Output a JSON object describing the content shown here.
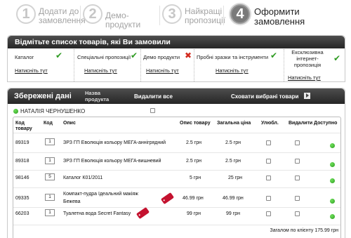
{
  "steps": [
    {
      "num": "1",
      "line1": "Додати до",
      "line2": "замовлення"
    },
    {
      "num": "2",
      "line1": "Демо-продукти",
      "line2": ""
    },
    {
      "num": "3",
      "line1": "Найкращі",
      "line2": "пропозиції"
    },
    {
      "num": "4",
      "line1": "Оформити",
      "line2": "замовлення"
    }
  ],
  "checklist": {
    "title": "Відмітьте список товарів, які Ви замовили",
    "items": [
      {
        "label": "Каталог",
        "status": "done",
        "link": "Натисніть тут"
      },
      {
        "label": "Спеціальні пропозиції",
        "status": "done",
        "link": "Натисніть тут"
      },
      {
        "label": "Демо продукти",
        "status": "missing",
        "link": "Натисніть тут"
      },
      {
        "label": "Пробні зразки та інструменти",
        "status": "done",
        "link": "Натисніть тут"
      },
      {
        "label": "Ексклюзивна інтернет-пропозиція",
        "status": "done",
        "link": "Натисніть тут"
      }
    ],
    "marks": {
      "done": "✔",
      "missing": "✖"
    }
  },
  "saved": {
    "title": "Збережені дані",
    "column_name": "Назва продукта",
    "delete_all": "Видалити все",
    "hide_selected": "Сховати вибрані товари",
    "customer": "НАТАЛІЯ ЧЕРНУШЕНКО",
    "headers": {
      "code_item": "Код товару",
      "code": "Код",
      "desc": "Опис",
      "desc_item": "Опис товару",
      "total_price": "Загальна ціна",
      "fav": "Улюбл.",
      "delete": "Видалити",
      "available": "Доступно"
    },
    "rows": [
      {
        "code_item": "89319",
        "qty": "1",
        "desc": "ЗРЗ ГП Еволюція кольору МЕГА-аннігрядний",
        "desc2": "",
        "unit_price": "2.5 грн",
        "total_price": "2.5 грн",
        "has_tag": false
      },
      {
        "code_item": "89318",
        "qty": "1",
        "desc": "ЗРЗ ГП Еволюція кольору МЕГА-вишневий",
        "desc2": "",
        "unit_price": "2.5 грн",
        "total_price": "2.5 грн",
        "has_tag": false
      },
      {
        "code_item": "98146",
        "qty": "5",
        "desc": "Каталог К01/2011",
        "desc2": "",
        "unit_price": "5 грн",
        "total_price": "25 грн",
        "has_tag": false
      },
      {
        "code_item": "09335",
        "qty": "1",
        "desc": "Компакт-пудра Ідеальний макіяж",
        "desc2": "Бежева",
        "unit_price": "46.99 грн",
        "total_price": "46.99 грн",
        "has_tag": true
      },
      {
        "code_item": "66203",
        "qty": "1",
        "desc": "Туалетна вода Secret Fantasy",
        "desc2": "",
        "unit_price": "99 грн",
        "total_price": "99 грн",
        "has_tag": true
      }
    ],
    "total": "Загалом по клієнту 175.99 грн"
  },
  "colors": {
    "accent_green": "#2f9b23",
    "accent_red": "#d22b1f",
    "tag_red": "#c4122f"
  }
}
